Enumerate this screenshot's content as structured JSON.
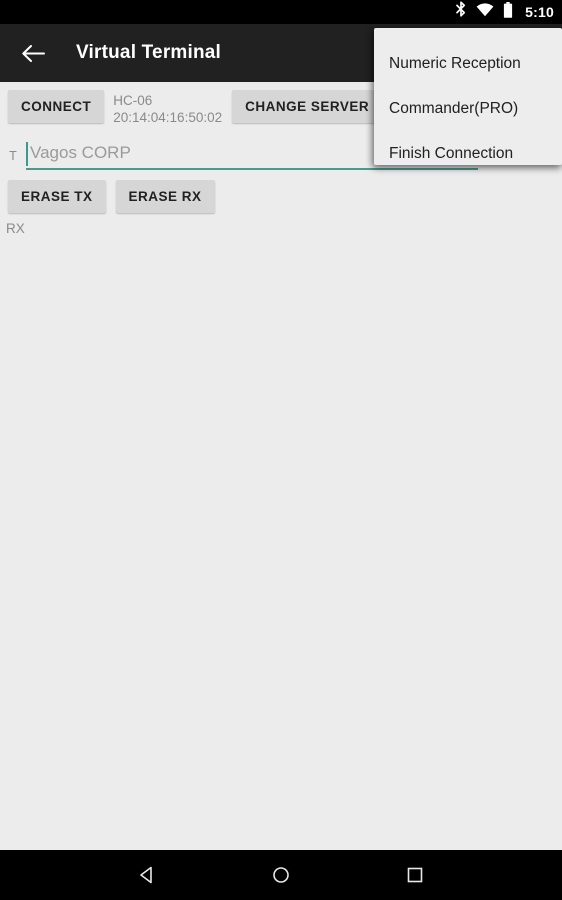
{
  "status_bar": {
    "time": "5:10",
    "icons": [
      "bluetooth-icon",
      "wifi-icon",
      "battery-icon"
    ]
  },
  "toolbar": {
    "back_icon": "back-arrow-icon",
    "title": "Virtual Terminal"
  },
  "content": {
    "connect_button": "CONNECT",
    "device_name": "HC-06",
    "device_address": "20:14:04:16:50:02",
    "change_server_button": "CHANGE SERVER",
    "tx_label": "T",
    "tx_placeholder": "Vagos CORP",
    "tx_value": "",
    "erase_tx_button": "ERASE TX",
    "erase_rx_button": "ERASE RX",
    "rx_label": "RX"
  },
  "overflow_menu": {
    "visible": true,
    "items": [
      {
        "label": "Numeric Reception"
      },
      {
        "label": "Commander(PRO)"
      },
      {
        "label": "Finish Connection"
      }
    ]
  },
  "nav_bar": {
    "back": "nav-back-icon",
    "home": "nav-home-icon",
    "recents": "nav-recents-icon"
  },
  "colors": {
    "toolbar": "#212121",
    "background": "#ececec",
    "accent_teal": "#4c9a8f",
    "button": "#d6d6d6",
    "menu": "#ededed"
  }
}
